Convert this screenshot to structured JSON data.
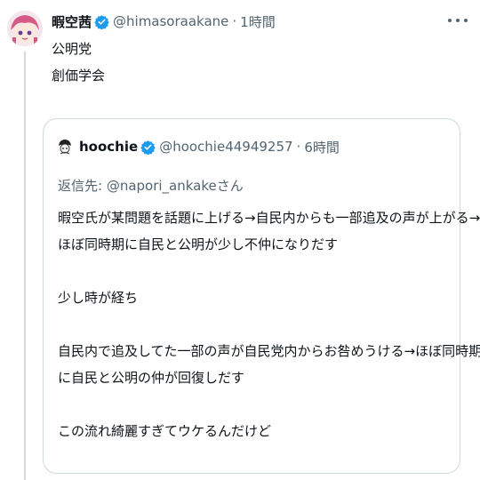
{
  "tweet": {
    "display_name": "暇空茜",
    "handle": "@himasoraakane",
    "separator": "·",
    "time": "1時間",
    "lines": [
      "公明党",
      "創価学会"
    ]
  },
  "quote": {
    "display_name": "hoochie",
    "handle": "@hoochie44949257",
    "separator": "·",
    "time": "6時間",
    "reply_prefix": "返信先: ",
    "reply_handle": "@napori_ankake",
    "reply_suffix": "さん",
    "lines": [
      "暇空氏が某問題を話題に上げる→自民内からも一部追及の声が上がる→",
      "ほぼ同時期に自民と公明が少し不仲になりだす",
      "",
      "少し時が経ち",
      "",
      "自民内で追及してた一部の声が自民党内からお咎めうける→ほぼ同時期",
      "に自民と公明の仲が回復しだす",
      "",
      "この流れ綺麗すぎてウケるんだけど"
    ]
  },
  "colors": {
    "verified": "#1d9bf0",
    "secondary_text": "#536471",
    "border": "#cfd9de"
  },
  "icons": {
    "verified": "verified-badge-icon",
    "more": "more-options-icon"
  }
}
